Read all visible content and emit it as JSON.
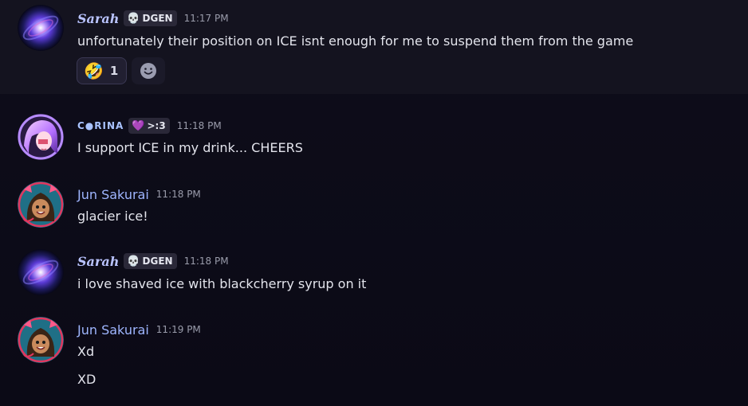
{
  "messages": [
    {
      "author": "Sarah",
      "tag": {
        "glyph": "💀",
        "label": "DGEN"
      },
      "time": "11:17 PM",
      "lines": [
        "unfortunately their position on ICE isnt enough for me to suspend them from the game"
      ],
      "reactions": [
        {
          "emoji": "🤣",
          "count": "1"
        }
      ],
      "add_reaction_icon": "smile-add-icon"
    },
    {
      "author": "C●RINA",
      "tag": {
        "glyph": "💜",
        "label": ">:3"
      },
      "time": "11:18 PM",
      "lines": [
        "I support ICE in my drink... CHEERS"
      ]
    },
    {
      "author": "Jun Sakurai",
      "time": "11:18 PM",
      "lines": [
        "glacier ice!"
      ]
    },
    {
      "author": "Sarah",
      "tag": {
        "glyph": "💀",
        "label": "DGEN"
      },
      "time": "11:18 PM",
      "lines": [
        "i love shaved ice with blackcherry syrup on it"
      ]
    },
    {
      "author": "Jun Sakurai",
      "time": "11:19 PM",
      "lines": [
        "Xd",
        "XD"
      ]
    }
  ],
  "colors": {
    "background": "#0b0a15",
    "hover_row": "#14131f",
    "sarah_name": "#b9c3ff",
    "corina_name": "#a9c3ff",
    "jun_name": "#9fb6ff",
    "timestamp": "#9a9cab"
  }
}
